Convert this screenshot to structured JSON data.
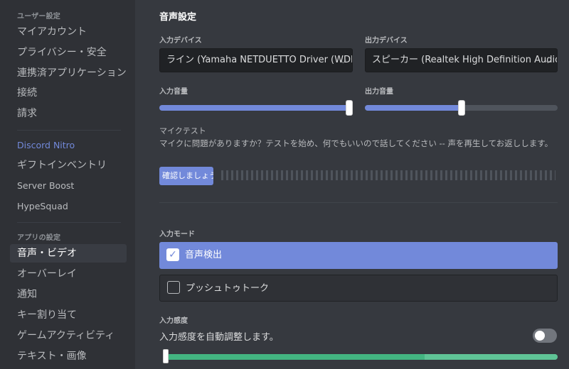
{
  "sidebar": {
    "user_settings_header": "ユーザー設定",
    "user_items": [
      "マイアカウント",
      "プライバシー・安全",
      "連携済アプリケーション",
      "接続",
      "請求"
    ],
    "nitro_item": "Discord Nitro",
    "nitro_items": [
      "ギフトインベントリ",
      "Server Boost",
      "HypeSquad"
    ],
    "app_settings_header": "アプリの設定",
    "app_items": [
      "音声・ビデオ",
      "オーバーレイ",
      "通知",
      "キー割り当て",
      "ゲームアクティビティ",
      "テキスト・画像"
    ],
    "selected_item": "音声・ビデオ"
  },
  "voice": {
    "title": "音声設定",
    "input_device_label": "入力デバイス",
    "input_device_value": "ライン (Yamaha NETDUETTO Driver (WDM))",
    "output_device_label": "出力デバイス",
    "output_device_value": "スピーカー (Realtek High Definition Audio)",
    "input_volume_label": "入力音量",
    "input_volume_fraction": 1.0,
    "output_volume_label": "出力音量",
    "output_volume_fraction": 0.5,
    "mic_test_title": "マイクテスト",
    "mic_test_desc": "マイクに問題がありますか？テストを始め、何でもいいので話してください -- 声を再生してお返しします。",
    "mic_test_button": "確認しましょう",
    "input_mode_label": "入力モード",
    "input_modes": [
      "音声検出",
      "プッシュトゥトーク"
    ],
    "selected_mode": "音声検出",
    "sensitivity_label": "入力感度",
    "auto_sensitivity_label": "入力感度を自動調整します。",
    "auto_sensitivity_enabled": false,
    "sensitivity_fraction": 0.0
  },
  "colors": {
    "accent": "#7289da",
    "background": "#36393f",
    "sidebar": "#2f3136",
    "green": "#43b581"
  }
}
